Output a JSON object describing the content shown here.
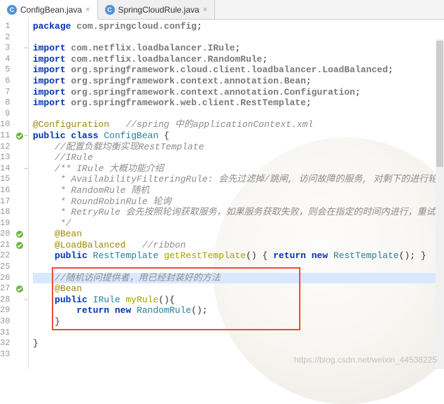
{
  "tabs": [
    {
      "icon": "C",
      "label": "ConfigBean.java",
      "active": true
    },
    {
      "icon": "C",
      "label": "SpringCloudRule.java",
      "active": false
    }
  ],
  "lines": [
    {
      "n": 1,
      "mark": "",
      "fold": "",
      "segs": [
        {
          "t": "kw",
          "v": "package "
        },
        {
          "t": "str-pkg",
          "v": "com.springcloud.config"
        },
        {
          "t": "punct",
          "v": ";"
        }
      ],
      "ind": 0
    },
    {
      "n": 2,
      "mark": "",
      "fold": "",
      "segs": [],
      "ind": 0
    },
    {
      "n": 3,
      "mark": "",
      "fold": "−",
      "segs": [
        {
          "t": "kw",
          "v": "import "
        },
        {
          "t": "str-pkg",
          "v": "com.netflix.loadbalancer.IRule"
        },
        {
          "t": "punct",
          "v": ";"
        }
      ],
      "ind": 0
    },
    {
      "n": 4,
      "mark": "",
      "fold": "",
      "segs": [
        {
          "t": "kw",
          "v": "import "
        },
        {
          "t": "str-pkg",
          "v": "com.netflix.loadbalancer.RandomRule"
        },
        {
          "t": "punct",
          "v": ";"
        }
      ],
      "ind": 0
    },
    {
      "n": 5,
      "mark": "",
      "fold": "",
      "segs": [
        {
          "t": "kw",
          "v": "import "
        },
        {
          "t": "str-pkg",
          "v": "org.springframework.cloud.client.loadbalancer.LoadBalanced"
        },
        {
          "t": "punct",
          "v": ";"
        }
      ],
      "ind": 0
    },
    {
      "n": 6,
      "mark": "",
      "fold": "",
      "segs": [
        {
          "t": "kw",
          "v": "import "
        },
        {
          "t": "str-pkg",
          "v": "org.springframework.context.annotation.Bean"
        },
        {
          "t": "punct",
          "v": ";"
        }
      ],
      "ind": 0
    },
    {
      "n": 7,
      "mark": "",
      "fold": "",
      "segs": [
        {
          "t": "kw",
          "v": "import "
        },
        {
          "t": "str-pkg",
          "v": "org.springframework.context.annotation.Configuration"
        },
        {
          "t": "punct",
          "v": ";"
        }
      ],
      "ind": 0
    },
    {
      "n": 8,
      "mark": "",
      "fold": "",
      "segs": [
        {
          "t": "kw",
          "v": "import "
        },
        {
          "t": "str-pkg",
          "v": "org.springframework.web.client.RestTemplate"
        },
        {
          "t": "punct",
          "v": ";"
        }
      ],
      "ind": 0
    },
    {
      "n": 9,
      "mark": "",
      "fold": "",
      "segs": [],
      "ind": 0
    },
    {
      "n": 10,
      "mark": "",
      "fold": "",
      "segs": [
        {
          "t": "ann",
          "v": "@Configuration"
        },
        {
          "t": "punct",
          "v": "   "
        },
        {
          "t": "cmt",
          "v": "//spring 中的applicationContext.xml"
        }
      ],
      "ind": 0
    },
    {
      "n": 11,
      "mark": "green",
      "fold": "−",
      "segs": [
        {
          "t": "kw",
          "v": "public class "
        },
        {
          "t": "cls",
          "v": "ConfigBean"
        },
        {
          "t": "punct",
          "v": " {"
        }
      ],
      "ind": 0
    },
    {
      "n": 12,
      "mark": "",
      "fold": "",
      "segs": [
        {
          "t": "cmt",
          "v": "//配置负载均衡实现RestTemplate"
        }
      ],
      "ind": 1
    },
    {
      "n": 13,
      "mark": "",
      "fold": "",
      "segs": [
        {
          "t": "cmt",
          "v": "//IRule"
        }
      ],
      "ind": 1
    },
    {
      "n": 14,
      "mark": "",
      "fold": "−",
      "segs": [
        {
          "t": "cmt",
          "v": "/** IRule 大概功能介绍"
        }
      ],
      "ind": 1
    },
    {
      "n": 15,
      "mark": "",
      "fold": "",
      "segs": [
        {
          "t": "cmt",
          "v": " * AvailabilityFilteringRule: 会先过滤掉/跳闸, 访问故障的服务, 对剩下的进行轮询"
        }
      ],
      "ind": 1
    },
    {
      "n": 16,
      "mark": "",
      "fold": "",
      "segs": [
        {
          "t": "cmt",
          "v": " * RandomRule 随机"
        }
      ],
      "ind": 1
    },
    {
      "n": 17,
      "mark": "",
      "fold": "",
      "segs": [
        {
          "t": "cmt",
          "v": " * RoundRobinRule 轮询"
        }
      ],
      "ind": 1
    },
    {
      "n": 18,
      "mark": "",
      "fold": "",
      "segs": [
        {
          "t": "cmt",
          "v": " * RetryRule 会先按照轮询获取服务，如果服务获取失败，则会在指定的时间内进行，重试"
        }
      ],
      "ind": 1
    },
    {
      "n": 19,
      "mark": "",
      "fold": "",
      "segs": [
        {
          "t": "cmt",
          "v": " */"
        }
      ],
      "ind": 1
    },
    {
      "n": 20,
      "mark": "green",
      "fold": "",
      "segs": [
        {
          "t": "ann",
          "v": "@Bean"
        }
      ],
      "ind": 1
    },
    {
      "n": 21,
      "mark": "green",
      "fold": "",
      "segs": [
        {
          "t": "ann",
          "v": "@LoadBalanced"
        },
        {
          "t": "punct",
          "v": "   "
        },
        {
          "t": "cmt",
          "v": "//ribbon"
        }
      ],
      "ind": 1
    },
    {
      "n": 22,
      "mark": "",
      "fold": "",
      "segs": [
        {
          "t": "kw",
          "v": "public "
        },
        {
          "t": "cls",
          "v": "RestTemplate"
        },
        {
          "t": "punct",
          "v": " "
        },
        {
          "t": "method",
          "v": "getRestTemplate"
        },
        {
          "t": "punct",
          "v": "() { "
        },
        {
          "t": "kw",
          "v": "return new "
        },
        {
          "t": "cls",
          "v": "RestTemplate"
        },
        {
          "t": "punct",
          "v": "(); }"
        }
      ],
      "ind": 1
    },
    {
      "n": 25,
      "mark": "",
      "fold": "",
      "segs": [],
      "ind": 0
    },
    {
      "n": 26,
      "mark": "",
      "fold": "",
      "hl": true,
      "segs": [
        {
          "t": "cmt",
          "v": "//随机访问提供者，用已经封装好的方法"
        }
      ],
      "ind": 1
    },
    {
      "n": 27,
      "mark": "green",
      "fold": "",
      "segs": [
        {
          "t": "ann",
          "v": "@Bean"
        }
      ],
      "ind": 1
    },
    {
      "n": 28,
      "mark": "",
      "fold": "−",
      "segs": [
        {
          "t": "kw",
          "v": "public "
        },
        {
          "t": "cls",
          "v": "IRule"
        },
        {
          "t": "punct",
          "v": " "
        },
        {
          "t": "method",
          "v": "myRule"
        },
        {
          "t": "punct",
          "v": "(){"
        }
      ],
      "ind": 1
    },
    {
      "n": 29,
      "mark": "",
      "fold": "",
      "segs": [
        {
          "t": "kw",
          "v": "return new "
        },
        {
          "t": "cls",
          "v": "RandomRule"
        },
        {
          "t": "punct",
          "v": "();"
        }
      ],
      "ind": 2
    },
    {
      "n": 30,
      "mark": "",
      "fold": "",
      "segs": [
        {
          "t": "punct",
          "v": "}"
        }
      ],
      "ind": 1
    },
    {
      "n": 31,
      "mark": "",
      "fold": "",
      "segs": [],
      "ind": 0
    },
    {
      "n": 32,
      "mark": "",
      "fold": "",
      "segs": [
        {
          "t": "punct",
          "v": "}"
        }
      ],
      "ind": 0
    },
    {
      "n": 33,
      "mark": "",
      "fold": "",
      "segs": [],
      "ind": 0
    }
  ],
  "watermark": "https://blog.csdn.net/weixin_44538225"
}
